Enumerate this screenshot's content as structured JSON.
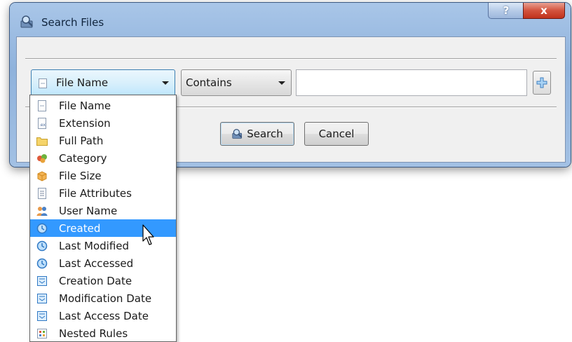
{
  "window": {
    "title": "Search Files",
    "help_label": "?",
    "close_label": "x"
  },
  "toolbar": {
    "field_selected": "File Name",
    "operator_selected": "Contains",
    "value": "",
    "add_label": "+"
  },
  "buttons": {
    "search_label": "Search",
    "cancel_label": "Cancel"
  },
  "dropdown": {
    "items": [
      {
        "label": "File Name",
        "icon": "file-name-icon"
      },
      {
        "label": "Extension",
        "icon": "extension-icon"
      },
      {
        "label": "Full Path",
        "icon": "folder-icon"
      },
      {
        "label": "Category",
        "icon": "category-icon"
      },
      {
        "label": "File Size",
        "icon": "file-size-icon"
      },
      {
        "label": "File Attributes",
        "icon": "file-attributes-icon"
      },
      {
        "label": "User Name",
        "icon": "user-icon"
      },
      {
        "label": "Created",
        "icon": "clock-icon"
      },
      {
        "label": "Last Modified",
        "icon": "clock-icon"
      },
      {
        "label": "Last Accessed",
        "icon": "clock-icon"
      },
      {
        "label": "Creation Date",
        "icon": "date-icon"
      },
      {
        "label": "Modification Date",
        "icon": "date-icon"
      },
      {
        "label": "Last Access Date",
        "icon": "date-icon"
      },
      {
        "label": "Nested Rules",
        "icon": "nested-rules-icon"
      }
    ],
    "selected_index": 7
  },
  "colors": {
    "selection": "#3399ff",
    "window_frame": "#9fbde2"
  }
}
